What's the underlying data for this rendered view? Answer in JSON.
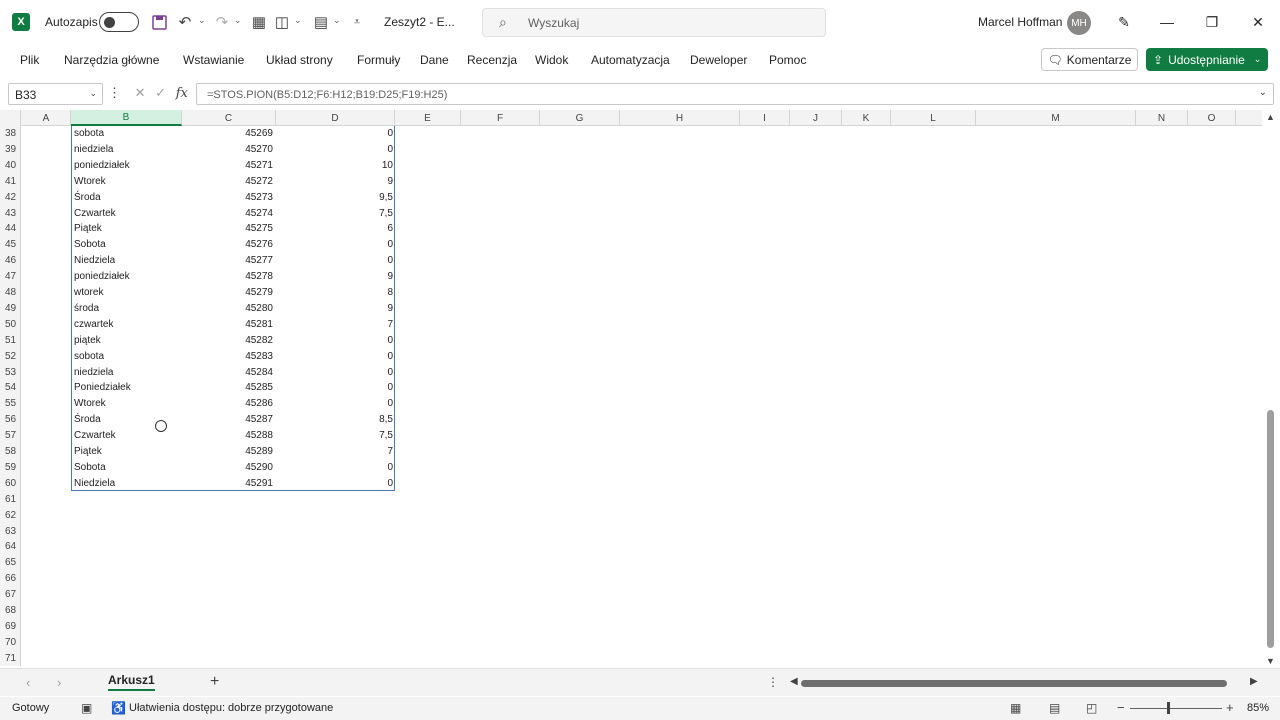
{
  "titlebar": {
    "autosave_label": "Autozapis",
    "doc_title": "Zeszyt2 - E...",
    "search_placeholder": "Wyszukaj",
    "user_name": "Marcel Hoffman",
    "user_initials": "MH"
  },
  "ribbon": {
    "tabs": [
      "Plik",
      "Narzędzia główne",
      "Wstawianie",
      "Układ strony",
      "Formuły",
      "Dane",
      "Recenzja",
      "Widok",
      "Automatyzacja",
      "Deweloper",
      "Pomoc"
    ],
    "comments_label": "Komentarze",
    "share_label": "Udostępnianie"
  },
  "formula_bar": {
    "name_box": "B33",
    "formula": "=STOS.PION(B5:D12;F6:H12;B19:D25;F19:H25)"
  },
  "grid": {
    "columns": [
      "A",
      "B",
      "C",
      "D",
      "E",
      "F",
      "G",
      "H",
      "I",
      "J",
      "K",
      "L",
      "M",
      "N",
      "O"
    ],
    "selected_column": "B",
    "row_numbers": [
      "38",
      "39",
      "40",
      "41",
      "42",
      "43",
      "44",
      "45",
      "46",
      "47",
      "48",
      "49",
      "50",
      "51",
      "52",
      "53",
      "54",
      "55",
      "56",
      "57",
      "58",
      "59",
      "60",
      "61",
      "62",
      "63",
      "64",
      "65",
      "66",
      "67",
      "68",
      "69",
      "70",
      "71"
    ],
    "rows": [
      {
        "b": "sobota",
        "c": "45269",
        "d": "0"
      },
      {
        "b": "niedziela",
        "c": "45270",
        "d": "0"
      },
      {
        "b": "poniedziałek",
        "c": "45271",
        "d": "10"
      },
      {
        "b": "Wtorek",
        "c": "45272",
        "d": "9"
      },
      {
        "b": "Środa",
        "c": "45273",
        "d": "9,5"
      },
      {
        "b": "Czwartek",
        "c": "45274",
        "d": "7,5"
      },
      {
        "b": "Piątek",
        "c": "45275",
        "d": "6"
      },
      {
        "b": "Sobota",
        "c": "45276",
        "d": "0"
      },
      {
        "b": "Niedziela",
        "c": "45277",
        "d": "0"
      },
      {
        "b": "poniedziałek",
        "c": "45278",
        "d": "9"
      },
      {
        "b": "wtorek",
        "c": "45279",
        "d": "8"
      },
      {
        "b": "środa",
        "c": "45280",
        "d": "9"
      },
      {
        "b": "czwartek",
        "c": "45281",
        "d": "7"
      },
      {
        "b": "piątek",
        "c": "45282",
        "d": "0"
      },
      {
        "b": "sobota",
        "c": "45283",
        "d": "0"
      },
      {
        "b": "niedziela",
        "c": "45284",
        "d": "0"
      },
      {
        "b": "Poniedziałek",
        "c": "45285",
        "d": "0"
      },
      {
        "b": "Wtorek",
        "c": "45286",
        "d": "0"
      },
      {
        "b": "Środa",
        "c": "45287",
        "d": "8,5"
      },
      {
        "b": "Czwartek",
        "c": "45288",
        "d": "7,5"
      },
      {
        "b": "Piątek",
        "c": "45289",
        "d": "7"
      },
      {
        "b": "Sobota",
        "c": "45290",
        "d": "0"
      },
      {
        "b": "Niedziela",
        "c": "45291",
        "d": "0"
      }
    ]
  },
  "sheets": {
    "active": "Arkusz1",
    "add_label": "+"
  },
  "statusbar": {
    "ready": "Gotowy",
    "accessibility": "Ułatwienia dostępu: dobrze przygotowane",
    "zoom": "85%"
  },
  "colors": {
    "accent": "#107c41",
    "selection_border": "#4a7ab5"
  }
}
